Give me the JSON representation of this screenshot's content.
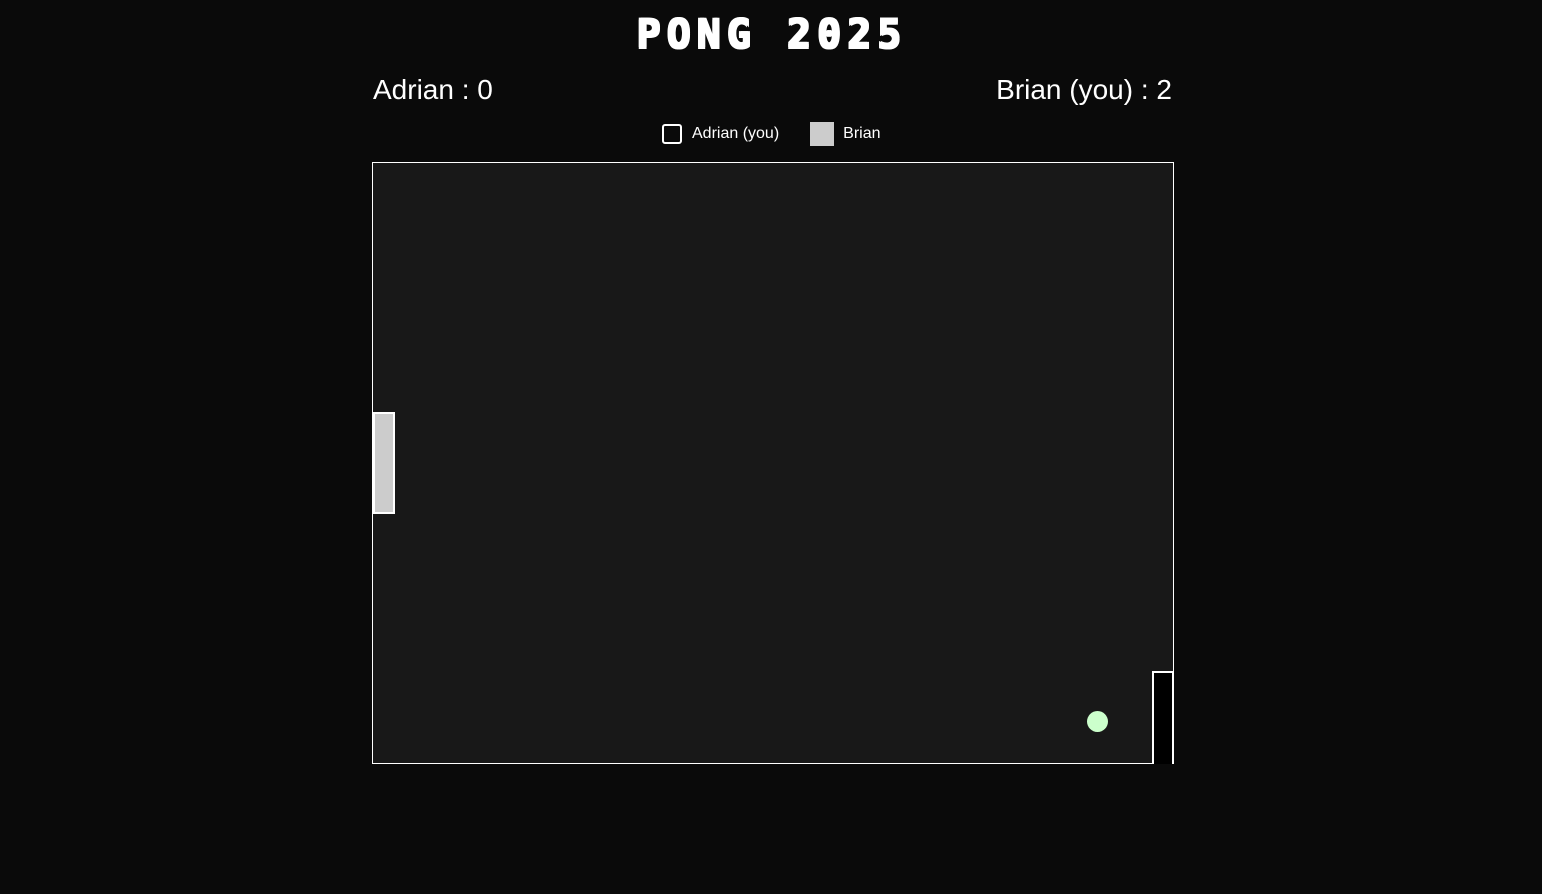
{
  "header": {
    "title": "PONG 2025"
  },
  "scoreboard": {
    "left": {
      "player": "Adrian",
      "label": "Adrian : 0",
      "score": 0
    },
    "right": {
      "player": "Brian (you)",
      "label": "Brian (you) : 2",
      "score": 2
    }
  },
  "legend": {
    "items": [
      {
        "label": "Adrian (you)",
        "swatch": "outline",
        "color": "#ffffff"
      },
      {
        "label": "Brian",
        "swatch": "filled",
        "color": "#cccccc"
      }
    ]
  },
  "court": {
    "background_color": "#181818",
    "border_color": "#ffffff"
  },
  "paddles": {
    "left": {
      "fill_color": "#cccccc",
      "outline_color": "#ffffff"
    },
    "right": {
      "fill_color": "#000000",
      "outline_color": "#ffffff"
    }
  },
  "ball": {
    "color": "#ccffcc"
  },
  "colors": {
    "page_background": "#0a0a0a",
    "text": "#ffffff"
  }
}
